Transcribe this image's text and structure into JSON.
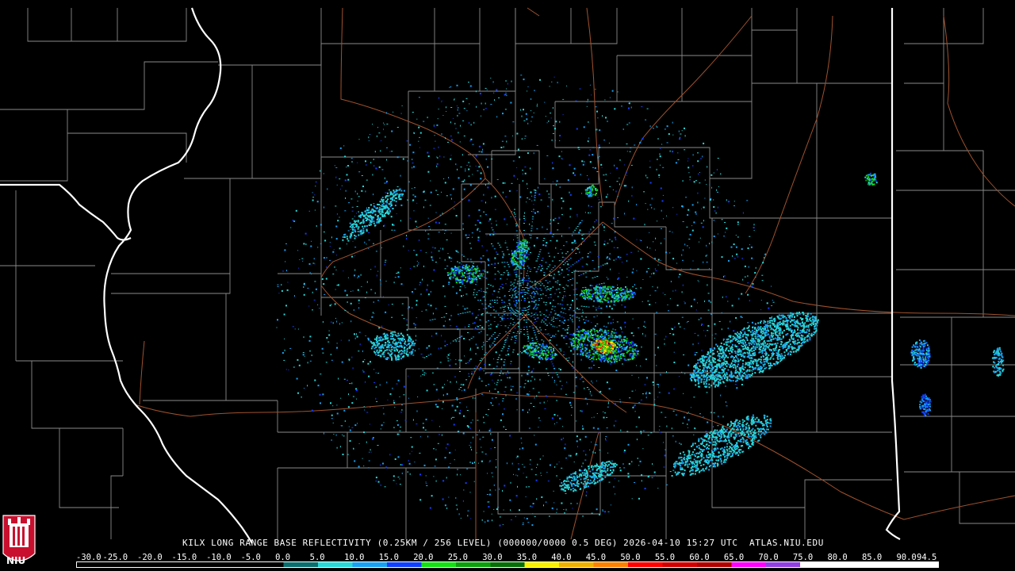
{
  "product": {
    "title": "KILX LONG RANGE BASE REFLECTIVITY (0.25KM / 256 LEVEL) (000000/0000 0.5 DEG) 2026-04-10 15:27 UTC  ATLAS.NIU.EDU"
  },
  "logo": {
    "text": "NIU"
  },
  "scale": {
    "labels": [
      "-30.0",
      "-25.0",
      "-20.0",
      "-15.0",
      "-10.0",
      "-5.0",
      "0.0",
      "5.0",
      "10.0",
      "15.0",
      "20.0",
      "25.0",
      "30.0",
      "35.0",
      "40.0",
      "45.0",
      "50.0",
      "55.0",
      "60.0",
      "65.0",
      "70.0",
      "75.0",
      "80.0",
      "85.0",
      "90.0",
      "94.5"
    ],
    "colors": [
      "#000000",
      "#000000",
      "#000000",
      "#000000",
      "#000000",
      "#000000",
      "#0a6e6e",
      "#2bd6d6",
      "#1aa0f0",
      "#1040ff",
      "#14e014",
      "#0ca00c",
      "#066e06",
      "#f8f000",
      "#f0b000",
      "#ff8000",
      "#ff0000",
      "#d00000",
      "#b00000",
      "#ff00ff",
      "#9040e0",
      "#ffffff",
      "#ffffff",
      "#ffffff",
      "#ffffff"
    ]
  }
}
